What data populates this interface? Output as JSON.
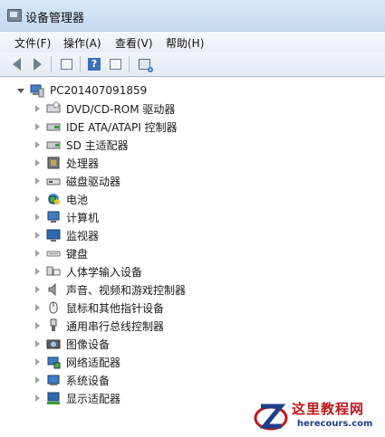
{
  "window": {
    "title": "设备管理器"
  },
  "menu": [
    {
      "label": "文件(F)"
    },
    {
      "label": "操作(A)"
    },
    {
      "label": "查看(V)"
    },
    {
      "label": "帮助(H)"
    }
  ],
  "toolbar": {
    "icons": [
      "back-arrow-icon",
      "forward-arrow-icon",
      "show-hide-tree-icon",
      "help-icon",
      "properties-icon",
      "scan-hardware-icon"
    ]
  },
  "tree": {
    "root": {
      "label": "PC201407091859",
      "icon": "computer-icon"
    },
    "items": [
      {
        "label": "DVD/CD-ROM 驱动器",
        "icon": "optical-drive-icon"
      },
      {
        "label": "IDE ATA/ATAPI 控制器",
        "icon": "ide-controller-icon"
      },
      {
        "label": "SD 主适配器",
        "icon": "sd-adapter-icon"
      },
      {
        "label": "处理器",
        "icon": "processor-icon"
      },
      {
        "label": "磁盘驱动器",
        "icon": "disk-drive-icon"
      },
      {
        "label": "电池",
        "icon": "battery-icon"
      },
      {
        "label": "计算机",
        "icon": "computer-icon"
      },
      {
        "label": "监视器",
        "icon": "monitor-icon"
      },
      {
        "label": "键盘",
        "icon": "keyboard-icon"
      },
      {
        "label": "人体学输入设备",
        "icon": "hid-icon"
      },
      {
        "label": "声音、视频和游戏控制器",
        "icon": "speaker-icon"
      },
      {
        "label": "鼠标和其他指针设备",
        "icon": "mouse-icon"
      },
      {
        "label": "通用串行总线控制器",
        "icon": "usb-icon"
      },
      {
        "label": "图像设备",
        "icon": "camera-icon"
      },
      {
        "label": "网络适配器",
        "icon": "network-adapter-icon"
      },
      {
        "label": "系统设备",
        "icon": "system-device-icon"
      },
      {
        "label": "显示适配器",
        "icon": "display-adapter-icon"
      }
    ]
  },
  "watermark": {
    "title": "这里教程网",
    "url": "herecours.com"
  },
  "colors": {
    "watermark_red": "#c0161c",
    "watermark_blue": "#1d3e8a"
  }
}
